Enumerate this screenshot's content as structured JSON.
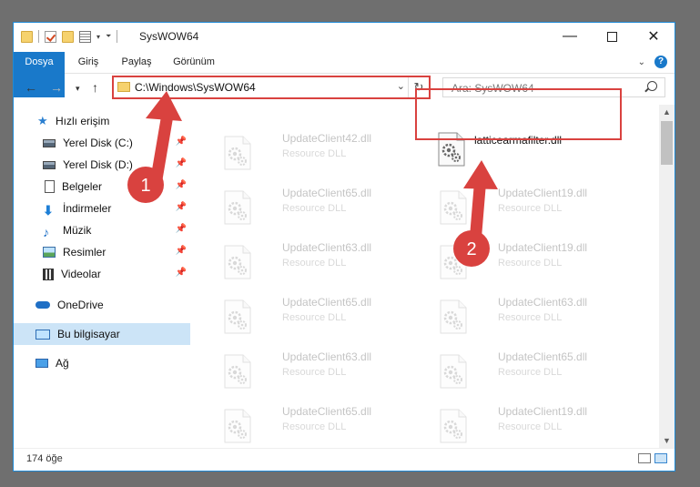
{
  "window": {
    "title": "SysWOW64"
  },
  "ribbon": {
    "tabs": [
      "Dosya",
      "Giriş",
      "Paylaş",
      "Görünüm"
    ]
  },
  "address": {
    "path": "C:\\Windows\\SysWOW64"
  },
  "search": {
    "placeholder": "Ara: SysWOW64"
  },
  "sidebar": {
    "items": [
      {
        "label": "Hızlı erişim",
        "icon": "star-icon"
      },
      {
        "label": "Yerel Disk (C:)",
        "icon": "disk-icon",
        "pinned": true
      },
      {
        "label": "Yerel Disk (D:)",
        "icon": "disk-icon",
        "pinned": true
      },
      {
        "label": "Belgeler",
        "icon": "document-icon",
        "pinned": true
      },
      {
        "label": "İndirmeler",
        "icon": "download-icon",
        "pinned": true
      },
      {
        "label": "Müzik",
        "icon": "music-icon",
        "pinned": true
      },
      {
        "label": "Resimler",
        "icon": "pictures-icon",
        "pinned": true
      },
      {
        "label": "Videolar",
        "icon": "video-icon",
        "pinned": true
      },
      {
        "label": "OneDrive",
        "icon": "onedrive-icon"
      },
      {
        "label": "Bu bilgisayar",
        "icon": "computer-icon",
        "selected": true
      },
      {
        "label": "Ağ",
        "icon": "network-icon"
      }
    ]
  },
  "files": {
    "highlighted": {
      "name": "latticearmafilter.dll"
    },
    "left_column": [
      {
        "name": "UpdateClient42.dll",
        "type": "Resource DLL"
      },
      {
        "name": "UpdateClient65.dll",
        "type": "Resource DLL"
      },
      {
        "name": "UpdateClient63.dll",
        "type": "Resource DLL"
      },
      {
        "name": "UpdateClient65.dll",
        "type": "Resource DLL"
      },
      {
        "name": "UpdateClient63.dll",
        "type": "Resource DLL"
      },
      {
        "name": "UpdateClient65.dll",
        "type": "Resource DLL"
      }
    ],
    "right_column": [
      {
        "name": "UpdateClient19.dll",
        "type": "Resource DLL"
      },
      {
        "name": "UpdateClient19.dll",
        "type": "Resource DLL"
      },
      {
        "name": "UpdateClient63.dll",
        "type": "Resource DLL"
      },
      {
        "name": "UpdateClient65.dll",
        "type": "Resource DLL"
      },
      {
        "name": "UpdateClient19.dll",
        "type": "Resource DLL"
      }
    ]
  },
  "status": {
    "count": "174 öğe"
  },
  "callouts": {
    "one": "1",
    "two": "2"
  },
  "colors": {
    "accent": "#1979ca",
    "highlight": "#d9423f"
  }
}
